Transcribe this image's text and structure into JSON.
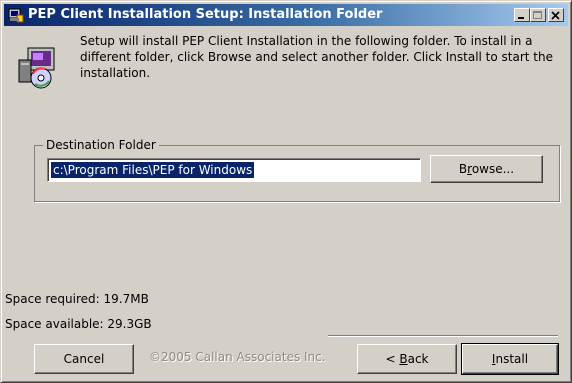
{
  "window": {
    "title": "PEP Client Installation Setup: Installation Folder",
    "controls": {
      "minimize": "minimize-icon",
      "maximize": "maximize-icon",
      "close": "close-icon"
    }
  },
  "header": {
    "icon": "installer-icon",
    "text": "Setup will install PEP Client Installation in the following folder. To install in a different folder, click Browse and select another folder. Click Install to start the installation."
  },
  "destination": {
    "legend": "Destination Folder",
    "path": "c:\\Program Files\\PEP for Windows",
    "browse_label": "Browse...",
    "browse_prefix": "B",
    "browse_accel": "r",
    "browse_suffix": "owse..."
  },
  "space": {
    "required": "Space required: 19.7MB",
    "available": "Space available: 29.3GB"
  },
  "footer": {
    "branding": "©2005 Callan Associates Inc.",
    "cancel_label": "Cancel",
    "back_prefix": "< ",
    "back_accel": "B",
    "back_suffix": "ack",
    "install_accel": "I",
    "install_suffix": "nstall"
  },
  "colors": {
    "title_start": "#0a246a",
    "title_end": "#a6caf0",
    "face": "#d4d0c8",
    "selection": "#0a246a"
  }
}
